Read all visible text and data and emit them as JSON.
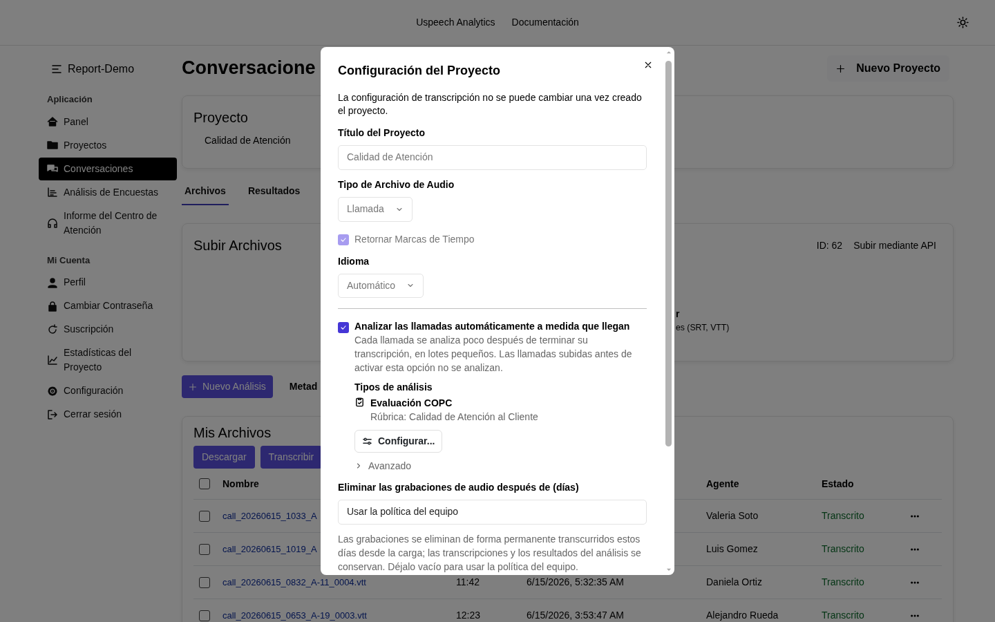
{
  "navbar": {
    "links": [
      "Uspeech Analytics",
      "Documentación"
    ]
  },
  "sidebar": {
    "brand": "Report-Demo",
    "sections": [
      {
        "title": "Aplicación",
        "items": [
          {
            "label": "Panel",
            "selected": false
          },
          {
            "label": "Proyectos",
            "selected": false
          },
          {
            "label": "Conversaciones",
            "selected": true
          },
          {
            "label": "Análisis de Encuestas",
            "selected": false
          },
          {
            "label": "Informe del Centro de Atención",
            "selected": false
          }
        ]
      },
      {
        "title": "Mi Cuenta",
        "items": [
          {
            "label": "Perfil",
            "selected": false
          },
          {
            "label": "Cambiar Contraseña",
            "selected": false
          },
          {
            "label": "Suscripción",
            "selected": false
          },
          {
            "label": "Estadísticas del Proyecto",
            "selected": false
          },
          {
            "label": "Configuración",
            "selected": false
          },
          {
            "label": "Cerrar sesión",
            "selected": false
          }
        ]
      }
    ]
  },
  "page": {
    "title": "Conversacione",
    "new_project_button": "Nuevo Proyecto"
  },
  "project_card": {
    "title": "Proyecto",
    "value": "Calidad de Atención"
  },
  "tabs": [
    {
      "label": "Archivos",
      "selected": true
    },
    {
      "label": "Resultados",
      "selected": false
    }
  ],
  "upload_card": {
    "title": "Subir Archivos",
    "id": "ID: 62",
    "api_link": "Subir mediante API",
    "partial_lines": [
      "r",
      "es (SRT, VTT)"
    ]
  },
  "toolbar": {
    "new_analysis_button": "Nuevo Análisis",
    "tab_partial": "Metad"
  },
  "files": {
    "title": "Mis Archivos",
    "buttons": [
      "Descargar",
      "Transcribir"
    ],
    "all_selected": false,
    "columns": [
      "Nombre",
      "Agente",
      "Estado"
    ],
    "rows": [
      {
        "name": "call_20260615_1033_A",
        "agent": "Valeria Soto",
        "status": "Transcrito",
        "selected": false
      },
      {
        "name": "call_20260615_1019_A",
        "agent": "Luis Gomez",
        "status": "Transcrito",
        "selected": false
      },
      {
        "name": "call_20260615_0832_A-11_0004.vtt",
        "duration": "11:42",
        "date": "6/15/2026, 5:32:35 AM",
        "agent": "Daniela Ortiz",
        "status": "Transcrito",
        "selected": false
      },
      {
        "name": "call_20260615_0653_A-19_0003.vtt",
        "duration": "12:23",
        "date": "6/15/2026, 3:53:47 AM",
        "agent": "Alejandro Rueda",
        "status": "Transcrito",
        "selected": false
      }
    ]
  },
  "modal": {
    "title": "Configuración del Proyecto",
    "note": "La configuración de transcripción no se puede cambiar una vez creado el proyecto.",
    "title_field": {
      "label": "Título del Proyecto",
      "value": "Calidad de Atención",
      "disabled": true
    },
    "audio_type": {
      "label": "Tipo de Archivo de Audio",
      "value": "Llamada",
      "disabled": true
    },
    "timestamps": {
      "label": "Retornar Marcas de Tiempo",
      "checked": true,
      "disabled": true
    },
    "language": {
      "label": "Idioma",
      "value": "Automático",
      "disabled": true
    },
    "auto_analyze": {
      "label": "Analizar las llamadas automáticamente a medida que llegan",
      "description": "Cada llamada se analiza poco después de terminar su transcripción, en lotes pequeños. Las llamadas subidas antes de activar esta opción no se analizan.",
      "checked": true,
      "disabled": false
    },
    "analysis_types": {
      "title": "Tipos de análisis",
      "items": [
        {
          "name": "Evaluación COPC",
          "rubric": "Rúbrica: Calidad de Atención al Cliente"
        }
      ],
      "configure_button": "Configurar...",
      "advanced": {
        "label": "Avanzado",
        "expanded": false
      }
    },
    "retention": {
      "label": "Eliminar las grabaciones de audio después de (días)",
      "placeholder": "Usar la política del equipo",
      "help": "Las grabaciones se eliminan de forma permanente transcurridos estos días desde la carga; las transcripciones y los resultados del análisis se conservan. Déjalo vacío para usar la política del equipo."
    }
  }
}
